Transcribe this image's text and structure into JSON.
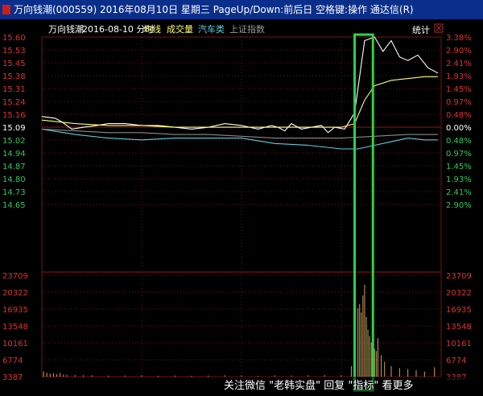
{
  "window": {
    "title": "万向钱潮(000559) 2016年08月10日 星期三 PageUp/Down:前后日 空格键:操作 通达信(R)"
  },
  "watermark": "关注微信 \"老韩实盘\" 回复 \"指标\" 看更多",
  "header": {
    "stock": "万向钱潮",
    "date_mode": "2016-08-10 分时",
    "avg_label": "均线",
    "vol_label": "成交量",
    "sector_label": "汽车类",
    "index_label": "上证指数",
    "stats_button": "统计"
  },
  "colors": {
    "up": "#e03030",
    "down": "#2ec95a",
    "neutral": "#ffffff",
    "price": "#ffffff",
    "avg": "#ffff66",
    "sector": "#5fd0e0",
    "index": "#8c8c8c",
    "grid": "#7a1010",
    "highlight": "#2bd24a",
    "volume": "#c9a35a"
  },
  "chart_data": {
    "type": "line",
    "price_axis": {
      "labels": [
        "15.60",
        "15.53",
        "15.45",
        "15.38",
        "15.31",
        "15.24",
        "15.16",
        "15.09",
        "15.02",
        "14.94",
        "14.87",
        "14.80",
        "14.73",
        "14.65"
      ],
      "prev_close": 15.09,
      "range": [
        14.61,
        15.6
      ]
    },
    "pct_axis": {
      "labels": [
        "3.38%",
        "2.90%",
        "2.41%",
        "1.93%",
        "1.45%",
        "0.97%",
        "0.48%",
        "0.00%",
        "0.48%",
        "0.97%",
        "1.45%",
        "1.93%",
        "2.41%",
        "2.90%"
      ]
    },
    "volume_axis": {
      "labels": [
        "23709",
        "20322",
        "16935",
        "13548",
        "10161",
        "6774",
        "3387"
      ],
      "range": [
        0,
        23709
      ]
    },
    "series": [
      {
        "key": "price",
        "x": [
          0,
          8,
          12,
          18,
          25,
          33,
          40,
          50,
          60,
          70,
          80,
          90,
          100,
          110,
          120,
          130,
          138,
          142,
          146,
          150,
          156,
          162,
          168,
          172,
          176,
          182,
          188,
          194,
          200,
          205,
          210,
          215,
          220,
          226,
          232,
          238
        ],
        "values": [
          15.16,
          15.15,
          15.13,
          15.09,
          15.1,
          15.11,
          15.12,
          15.12,
          15.11,
          15.11,
          15.1,
          15.09,
          15.1,
          15.12,
          15.11,
          15.09,
          15.11,
          15.1,
          15.08,
          15.12,
          15.09,
          15.1,
          15.11,
          15.07,
          15.1,
          15.09,
          15.18,
          15.58,
          15.6,
          15.52,
          15.58,
          15.49,
          15.47,
          15.5,
          15.43,
          15.4
        ]
      },
      {
        "key": "avg",
        "x": [
          0,
          20,
          40,
          60,
          80,
          100,
          120,
          140,
          160,
          180,
          188,
          194,
          200,
          210,
          220,
          230,
          238
        ],
        "values": [
          15.14,
          15.12,
          15.11,
          15.11,
          15.1,
          15.1,
          15.1,
          15.1,
          15.1,
          15.1,
          15.12,
          15.25,
          15.33,
          15.36,
          15.37,
          15.38,
          15.38
        ]
      },
      {
        "key": "sector",
        "x": [
          0,
          20,
          40,
          60,
          80,
          100,
          120,
          140,
          160,
          180,
          190,
          200,
          210,
          220,
          230,
          238
        ],
        "values": [
          15.09,
          15.06,
          15.04,
          15.03,
          15.04,
          15.04,
          15.04,
          15.01,
          15.0,
          14.98,
          14.98,
          15.0,
          15.02,
          15.04,
          15.03,
          15.03
        ]
      },
      {
        "key": "index",
        "x": [
          0,
          20,
          40,
          60,
          80,
          100,
          120,
          140,
          160,
          180,
          200,
          220,
          238
        ],
        "values": [
          15.09,
          15.08,
          15.07,
          15.07,
          15.06,
          15.06,
          15.05,
          15.04,
          15.04,
          15.04,
          15.05,
          15.06,
          15.06
        ]
      }
    ],
    "volume": {
      "x": [
        1,
        3,
        5,
        7,
        9,
        11,
        13,
        15,
        20,
        25,
        30,
        40,
        50,
        60,
        70,
        80,
        90,
        100,
        110,
        120,
        130,
        140,
        150,
        160,
        170,
        180,
        186,
        188,
        190,
        191,
        192,
        193,
        194,
        195,
        196,
        197,
        198,
        199,
        200,
        201,
        202,
        204,
        206,
        210,
        215,
        220,
        225,
        230,
        236
      ],
      "values": [
        1200,
        900,
        700,
        800,
        600,
        900,
        500,
        400,
        350,
        300,
        300,
        250,
        250,
        300,
        200,
        250,
        200,
        250,
        300,
        250,
        200,
        300,
        250,
        300,
        350,
        300,
        2500,
        18000,
        16000,
        17000,
        15000,
        19000,
        21500,
        14000,
        11000,
        9500,
        8000,
        7000,
        6500,
        6000,
        9000,
        5000,
        3500,
        2500,
        2000,
        1800,
        1500,
        1200,
        2200
      ]
    },
    "highlight_range": [
      188,
      199
    ],
    "x_range": [
      0,
      240
    ]
  }
}
